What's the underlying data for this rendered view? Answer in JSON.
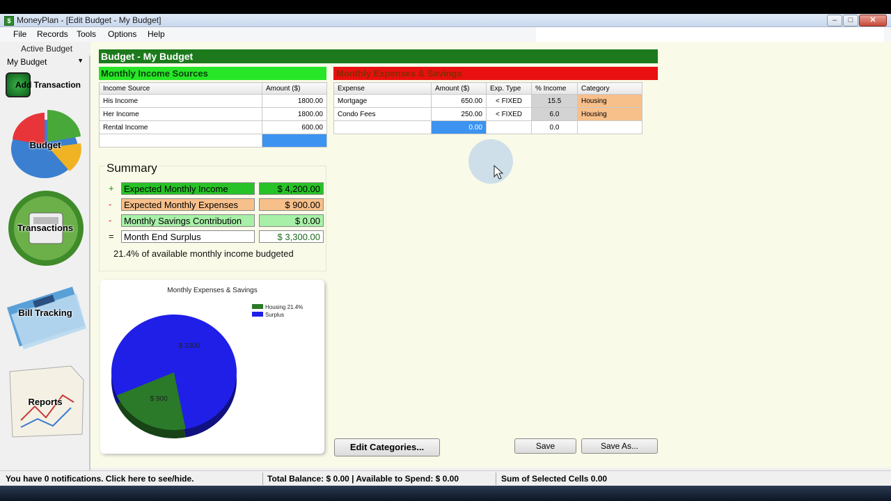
{
  "window": {
    "title": "MoneyPlan - [Edit Budget - My Budget]",
    "app_icon": "money-icon"
  },
  "menu": [
    "File",
    "Records",
    "Tools",
    "Options",
    "Help"
  ],
  "sidebar": {
    "active_budget_label": "Active Budget",
    "active_budget_value": "My Budget",
    "add_transaction": "Add Transaction",
    "nav": [
      {
        "label": "Budget",
        "icon": "pie-chart-icon"
      },
      {
        "label": "Transactions",
        "icon": "cash-register-icon"
      },
      {
        "label": "Bill Tracking",
        "icon": "credit-card-icon"
      },
      {
        "label": "Reports",
        "icon": "report-chart-icon"
      }
    ]
  },
  "budget": {
    "title": "Budget - My Budget",
    "income_header": "Monthly Income Sources",
    "income_columns": [
      "Income Source",
      "Amount ($)"
    ],
    "income_rows": [
      [
        "His Income",
        "1800.00"
      ],
      [
        "Her Income",
        "1800.00"
      ],
      [
        "Rental Income",
        "600.00"
      ]
    ],
    "expense_header": "Monthly Expenses & Savings",
    "expense_columns": [
      "Expense",
      "Amount ($)",
      "Exp. Type",
      "% Income",
      "Category"
    ],
    "expense_rows": [
      [
        "Mortgage",
        "650.00",
        "< FIXED",
        "15.5",
        "Housing"
      ],
      [
        "Condo Fees",
        "250.00",
        "< FIXED",
        "6.0",
        "Housing"
      ],
      [
        "",
        "0.00",
        "",
        "0.0",
        ""
      ]
    ]
  },
  "summary": {
    "title": "Summary",
    "rows": [
      {
        "sign": "+",
        "label": "Expected Monthly Income",
        "value": "$  4,200.00"
      },
      {
        "sign": "-",
        "label": "Expected Monthly Expenses",
        "value": "$  900.00"
      },
      {
        "sign": "-",
        "label": "Monthly Savings Contribution",
        "value": "$  0.00"
      },
      {
        "sign": "=",
        "label": "Month End Surplus",
        "value": "$  3,300.00"
      }
    ],
    "budgeted_text": "21.4% of available monthly income budgeted"
  },
  "chart_data": {
    "type": "pie",
    "title": "Monthly Expenses & Savings",
    "slices": [
      {
        "name": "Housing 21.4%",
        "value": 900,
        "label": "$ 900",
        "color": "#2a7a2a"
      },
      {
        "name": "Surplus",
        "value": 3300,
        "label": "$ 3300",
        "color": "#1f1fe8"
      }
    ],
    "legend": "top-right"
  },
  "buttons": {
    "edit_categories": "Edit Categories...",
    "save": "Save",
    "save_as": "Save As..."
  },
  "status": {
    "notifications": "You have 0 notifications.  Click here to see/hide.",
    "balance": "Total Balance:  $  0.00  |  Available to Spend:  $  0.00",
    "selected": "Sum of Selected Cells 0.00"
  },
  "colors": {
    "title_green": "#1c7a1c",
    "income_green": "#27e627",
    "expense_red": "#e81010",
    "category_orange": "#f7bf8a"
  }
}
